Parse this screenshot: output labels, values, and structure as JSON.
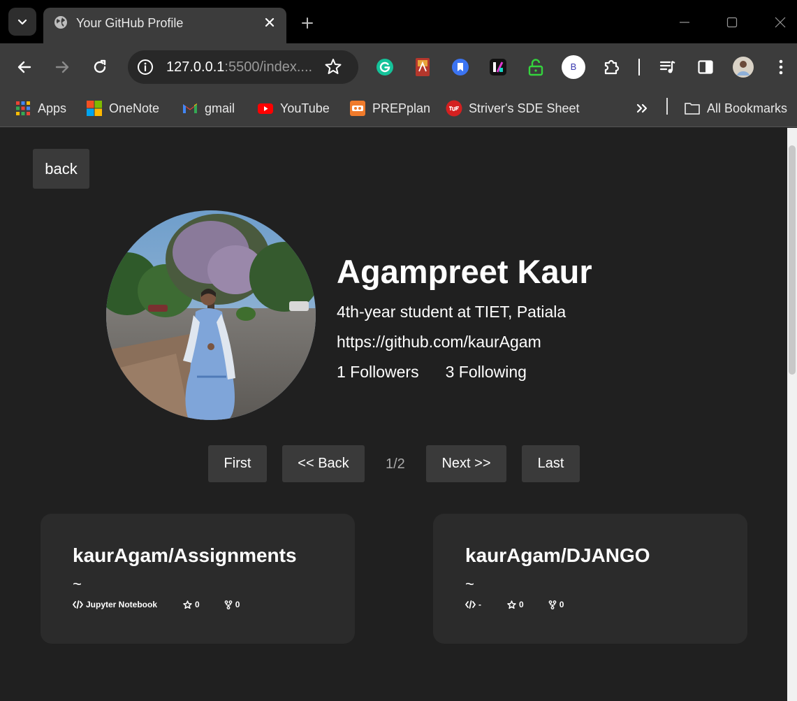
{
  "browser": {
    "tab_title": "Your GitHub Profile",
    "url_host": "127.0.0.1",
    "url_rest": ":5500/index....",
    "profile_initial": "B",
    "bookmarks": [
      {
        "label": "Apps",
        "icon": "apps-grid-icon"
      },
      {
        "label": "OneNote",
        "icon": "onenote-icon"
      },
      {
        "label": "gmail",
        "icon": "gmail-icon"
      },
      {
        "label": "YouTube",
        "icon": "youtube-icon"
      },
      {
        "label": "PREPplan",
        "icon": "prepplan-icon"
      },
      {
        "label": "Striver's SDE Sheet",
        "icon": "tuf-icon"
      }
    ],
    "all_bookmarks": "All Bookmarks"
  },
  "page": {
    "back_label": "back",
    "profile": {
      "name": "Agampreet Kaur",
      "bio": "4th-year student at TIET, Patiala",
      "url": "https://github.com/kaurAgam",
      "followers": "1 Followers",
      "following": "3 Following"
    },
    "pagination": {
      "first": "First",
      "back": "<< Back",
      "count": "1/2",
      "next": "Next >>",
      "last": "Last"
    },
    "repos": [
      {
        "name": "kaurAgam/Assignments",
        "description": "~",
        "language": "Jupyter Notebook",
        "stars": "0",
        "forks": "0"
      },
      {
        "name": "kaurAgam/DJANGO",
        "description": "~",
        "language": "-",
        "stars": "0",
        "forks": "0"
      }
    ]
  },
  "colors": {
    "page_bg": "#202020",
    "card_bg": "#2b2b2b",
    "button_bg": "#3a3a3a",
    "chrome_bg": "#3c3c3c"
  }
}
